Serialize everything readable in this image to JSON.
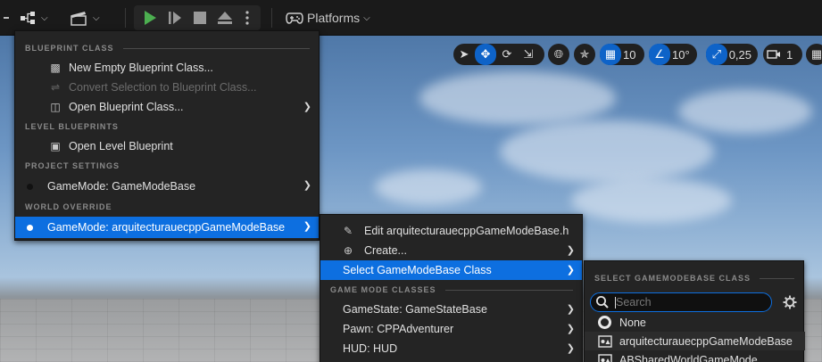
{
  "colors": {
    "accent": "#0d6fe0",
    "play": "#4caf50",
    "menu_bg": "#242424",
    "toolbar_bg": "#1a1a1a"
  },
  "toolbar": {
    "platforms_label": "Platforms",
    "icons": [
      "blueprint-icon",
      "cinematics-icon",
      "play-icon",
      "step-icon",
      "stop-icon",
      "eject-icon",
      "more-icon",
      "gamepad-icon"
    ]
  },
  "viewport_tools": {
    "grid_snap_value": "10",
    "rotation_snap_value": "10°",
    "scale_snap_value": "0,25",
    "camera_speed_value": "1"
  },
  "blueprint_menu": {
    "sections": [
      {
        "title": "BLUEPRINT CLASS",
        "items": [
          {
            "label": "New Empty Blueprint Class...",
            "icon": "new-blueprint-icon",
            "disabled": false,
            "submenu": false
          },
          {
            "label": "Convert Selection to Blueprint Class...",
            "icon": "convert-icon",
            "disabled": true,
            "submenu": false
          },
          {
            "label": "Open Blueprint Class...",
            "icon": "open-blueprint-icon",
            "disabled": false,
            "submenu": true
          }
        ]
      },
      {
        "title": "LEVEL BLUEPRINTS",
        "items": [
          {
            "label": "Open Level Blueprint",
            "icon": "level-blueprint-icon",
            "disabled": false,
            "submenu": false
          }
        ]
      },
      {
        "title": "PROJECT SETTINGS",
        "items": [
          {
            "label": "GameMode: GameModeBase",
            "icon": "dot",
            "disabled": false,
            "submenu": true
          }
        ]
      },
      {
        "title": "WORLD OVERRIDE",
        "items": [
          {
            "label": "GameMode: arquitecturauecppGameModeBase",
            "icon": "dot",
            "disabled": false,
            "submenu": true,
            "selected": true
          }
        ]
      }
    ]
  },
  "gamemode_menu": {
    "items": [
      {
        "label": "Edit arquitecturauecppGameModeBase.h",
        "icon": "edit-icon",
        "submenu": false
      },
      {
        "label": "Create...",
        "icon": "create-icon",
        "submenu": true
      },
      {
        "label": "Select GameModeBase Class",
        "icon": "",
        "submenu": true,
        "selected": true
      }
    ],
    "section_title": "GAME MODE CLASSES",
    "class_items": [
      {
        "label": "GameState: GameStateBase"
      },
      {
        "label": "Pawn: CPPAdventurer"
      },
      {
        "label": "HUD: HUD"
      }
    ]
  },
  "class_picker": {
    "title": "SELECT GAMEMODEBASE CLASS",
    "search_placeholder": "Search",
    "options": [
      {
        "label": "None",
        "icon": "none-icon"
      },
      {
        "label": "arquitecturauecppGameModeBase",
        "icon": "class-icon"
      },
      {
        "label": "ABSharedWorldGameMode",
        "icon": "class-icon"
      }
    ]
  }
}
